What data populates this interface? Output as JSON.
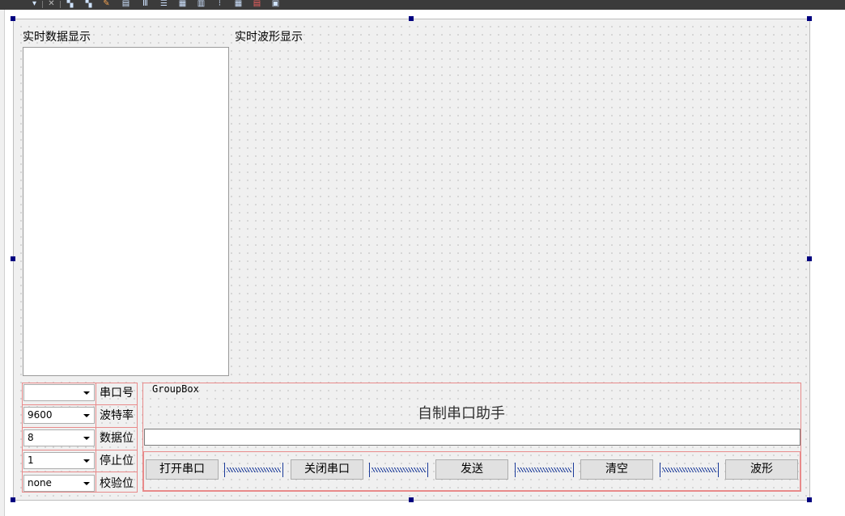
{
  "toolbar": {
    "icons": [
      "dropdown-icon",
      "close-icon",
      "layout-icon-1",
      "layout-icon-2",
      "edit-icon",
      "preview-icon",
      "columns-icon",
      "rows-icon",
      "grid-icon",
      "align-icon",
      "split-icon",
      "table-icon",
      "break-icon",
      "adjust-icon"
    ]
  },
  "form": {
    "data_display_label": "实时数据显示",
    "wave_display_label": "实时波形显示"
  },
  "serial_settings": [
    {
      "value": "",
      "label": "串口号"
    },
    {
      "value": "9600",
      "label": "波特率"
    },
    {
      "value": "8",
      "label": "数据位"
    },
    {
      "value": "1",
      "label": "停止位"
    },
    {
      "value": "none",
      "label": "校验位"
    }
  ],
  "groupbox": {
    "title": "GroupBox",
    "app_title": "自制串口助手",
    "send_input_value": ""
  },
  "buttons": {
    "open": "打开串口",
    "close": "关闭串口",
    "send": "发送",
    "clear": "清空",
    "wave": "波形"
  },
  "colors": {
    "layout_border": "#e88a8a",
    "spacer": "#1a3a9a",
    "handle": "#000080"
  }
}
